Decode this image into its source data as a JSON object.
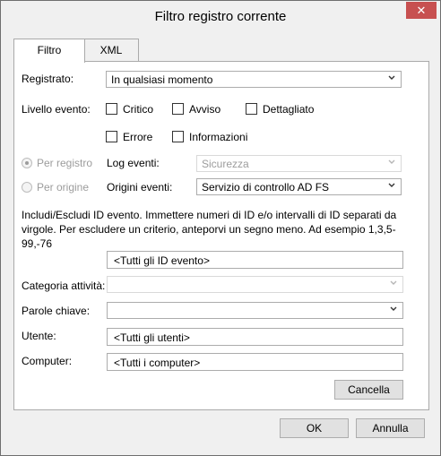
{
  "window": {
    "title": "Filtro registro corrente",
    "close_glyph": "✕"
  },
  "tabs": [
    {
      "label": "Filtro"
    },
    {
      "label": "XML"
    }
  ],
  "filter": {
    "logged_label": "Registrato:",
    "logged_value": "In qualsiasi momento",
    "level_label": "Livello evento:",
    "levels": {
      "critical": "Critico",
      "warning": "Avviso",
      "verbose": "Dettagliato",
      "error": "Errore",
      "information": "Informazioni"
    },
    "by_log_label": "Per registro",
    "by_source_label": "Per origine",
    "event_logs_label": "Log eventi:",
    "event_logs_value": "Sicurezza",
    "event_sources_label": "Origini eventi:",
    "event_sources_value": "Servizio di controllo AD FS",
    "description_line1": "Includi/Escludi ID evento. Immettere numeri di ID e/o intervalli di ID separati da",
    "description_line2": "virgole. Per escludere un criterio, anteporvi un segno meno. Ad esempio 1,3,5-99,-76",
    "event_ids_value": "<Tutti gli ID evento>",
    "task_category_label": "Categoria attività:",
    "keywords_label": "Parole chiave:",
    "user_label": "Utente:",
    "user_value": "<Tutti gli utenti>",
    "computer_label": "Computer:",
    "computer_value": "<Tutti i computer>",
    "clear_label": "Cancella"
  },
  "footer": {
    "ok_label": "OK",
    "cancel_label": "Annulla"
  },
  "icons": {
    "dropdown": "chevron-down-icon",
    "close": "close-icon"
  }
}
